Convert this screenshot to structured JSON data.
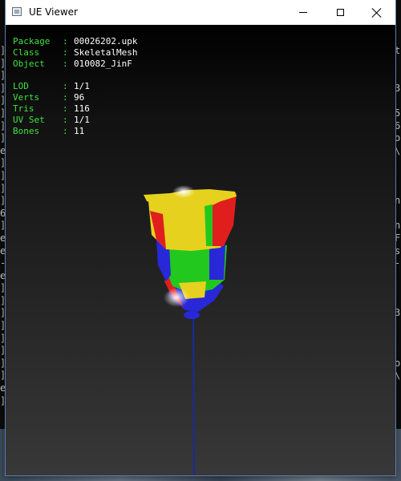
{
  "window": {
    "title": "UE Viewer"
  },
  "info_block_1": [
    {
      "label": "Package",
      "value": "00026202.upk"
    },
    {
      "label": "Class",
      "value": "SkeletalMesh"
    },
    {
      "label": "Object",
      "value": "010082_JinF"
    }
  ],
  "info_block_2": [
    {
      "label": "LOD",
      "value": "1/1"
    },
    {
      "label": "Verts",
      "value": "96"
    },
    {
      "label": "Tris",
      "value": "116"
    },
    {
      "label": "UV Set",
      "value": "1/1"
    },
    {
      "label": "Bones",
      "value": "11"
    }
  ],
  "info_colors": {
    "label": "#3ee23e",
    "value": "#ffffff"
  },
  "mesh_colors": {
    "yellow": "#e6d21e",
    "red": "#e01e1e",
    "green": "#22c81e",
    "blue": "#2828d8",
    "bone": "#1a2aa0"
  },
  "background_console": {
    "left_chars": [
      "]",
      "]",
      "]",
      "]",
      "]",
      "]",
      "]",
      "]",
      "e",
      "]",
      "]",
      "]",
      "]",
      "6",
      "]",
      "e",
      "e",
      "-",
      "e",
      "]",
      "]",
      "]",
      "]",
      "]",
      "]",
      "]",
      "]",
      "e",
      "]"
    ],
    "right_chars": [
      "t",
      "",
      "",
      "3",
      "",
      "5",
      "6",
      "o",
      "\\",
      "",
      "",
      "",
      "n",
      "",
      "n",
      "F",
      "s",
      "-",
      "",
      "",
      "",
      "3",
      "",
      "",
      "",
      "o",
      "\\"
    ]
  }
}
